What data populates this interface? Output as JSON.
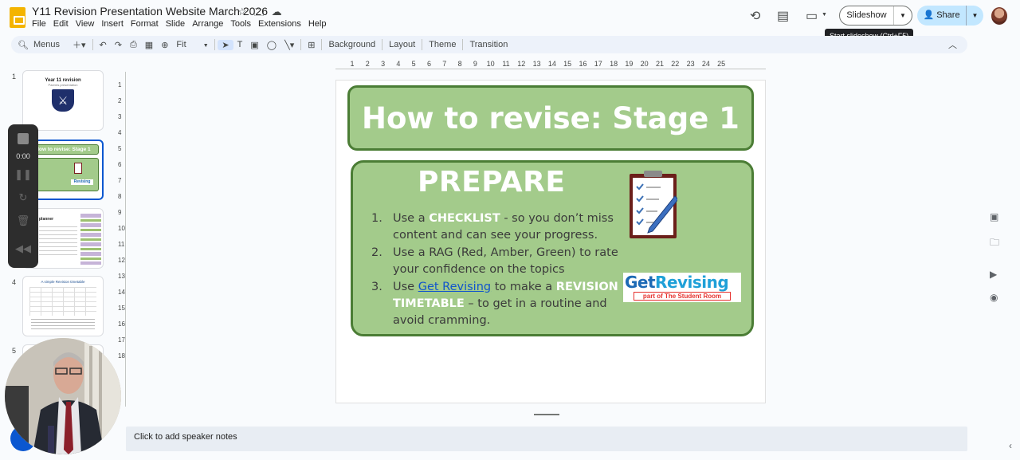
{
  "app": {
    "title": "Y11 Revision Presentation Website March 2026",
    "menu": [
      "File",
      "Edit",
      "View",
      "Insert",
      "Format",
      "Slide",
      "Arrange",
      "Tools",
      "Extensions",
      "Help"
    ],
    "title_icons": [
      "star-icon",
      "folder-move-icon",
      "cloud-status-icon"
    ]
  },
  "header": {
    "history_icon": "history-icon",
    "comments_icon": "comment-icon",
    "meet_icon": "video-camera-icon",
    "slideshow_label": "Slideshow",
    "share_label": "Share",
    "tooltip": "Start slideshow (Ctrl+F5)"
  },
  "toolbar": {
    "menus_label": "Menus",
    "zoom_label": "Fit",
    "background": "Background",
    "layout": "Layout",
    "theme": "Theme",
    "transition": "Transition"
  },
  "ruler": {
    "h_ticks": [
      "1",
      "2",
      "3",
      "4",
      "5",
      "6",
      "7",
      "8",
      "9",
      "10",
      "11",
      "12",
      "13",
      "14",
      "15",
      "16",
      "17",
      "18",
      "19",
      "20",
      "21",
      "22",
      "23",
      "24",
      "25"
    ],
    "v_ticks": [
      "1",
      "2",
      "3",
      "4",
      "5",
      "6",
      "7",
      "8",
      "9",
      "10",
      "11",
      "12",
      "13",
      "14",
      "15",
      "16",
      "17",
      "18"
    ]
  },
  "filmstrip": {
    "slides": [
      {
        "num": "1",
        "title": "Year 11 revision",
        "subtitle": "Parents presentation"
      },
      {
        "num": "2",
        "title": "How to revise: Stage 1"
      },
      {
        "num": "3",
        "title": "planner"
      },
      {
        "num": "4",
        "title": "A simple Revision timetable"
      },
      {
        "num": "5",
        "title": ""
      }
    ]
  },
  "recorder": {
    "time": "0:00"
  },
  "slide": {
    "title": "How to revise: Stage 1",
    "heading": "PREPARE",
    "items": [
      {
        "n": "1.",
        "pre": "Use a ",
        "hl": "CHECKLIST",
        "post": " - so you don’t miss content and can see your progress."
      },
      {
        "n": "2.",
        "text": "Use a RAG (Red, Amber, Green) to rate your confidence on the topics"
      },
      {
        "n": "3.",
        "pre": "Use ",
        "link": "Get Revising",
        "mid": " to make a ",
        "hl": "REVISION TIMETABLE",
        "post": " – to get in a routine and avoid cramming."
      }
    ],
    "logo_main_1": "Get",
    "logo_main_2": "Revising",
    "logo_sub": "part of The Student Room",
    "colors": {
      "box_fill": "#a3cb8b",
      "box_border": "#4b7d35"
    }
  },
  "notes": {
    "placeholder": "Click to add speaker notes"
  }
}
